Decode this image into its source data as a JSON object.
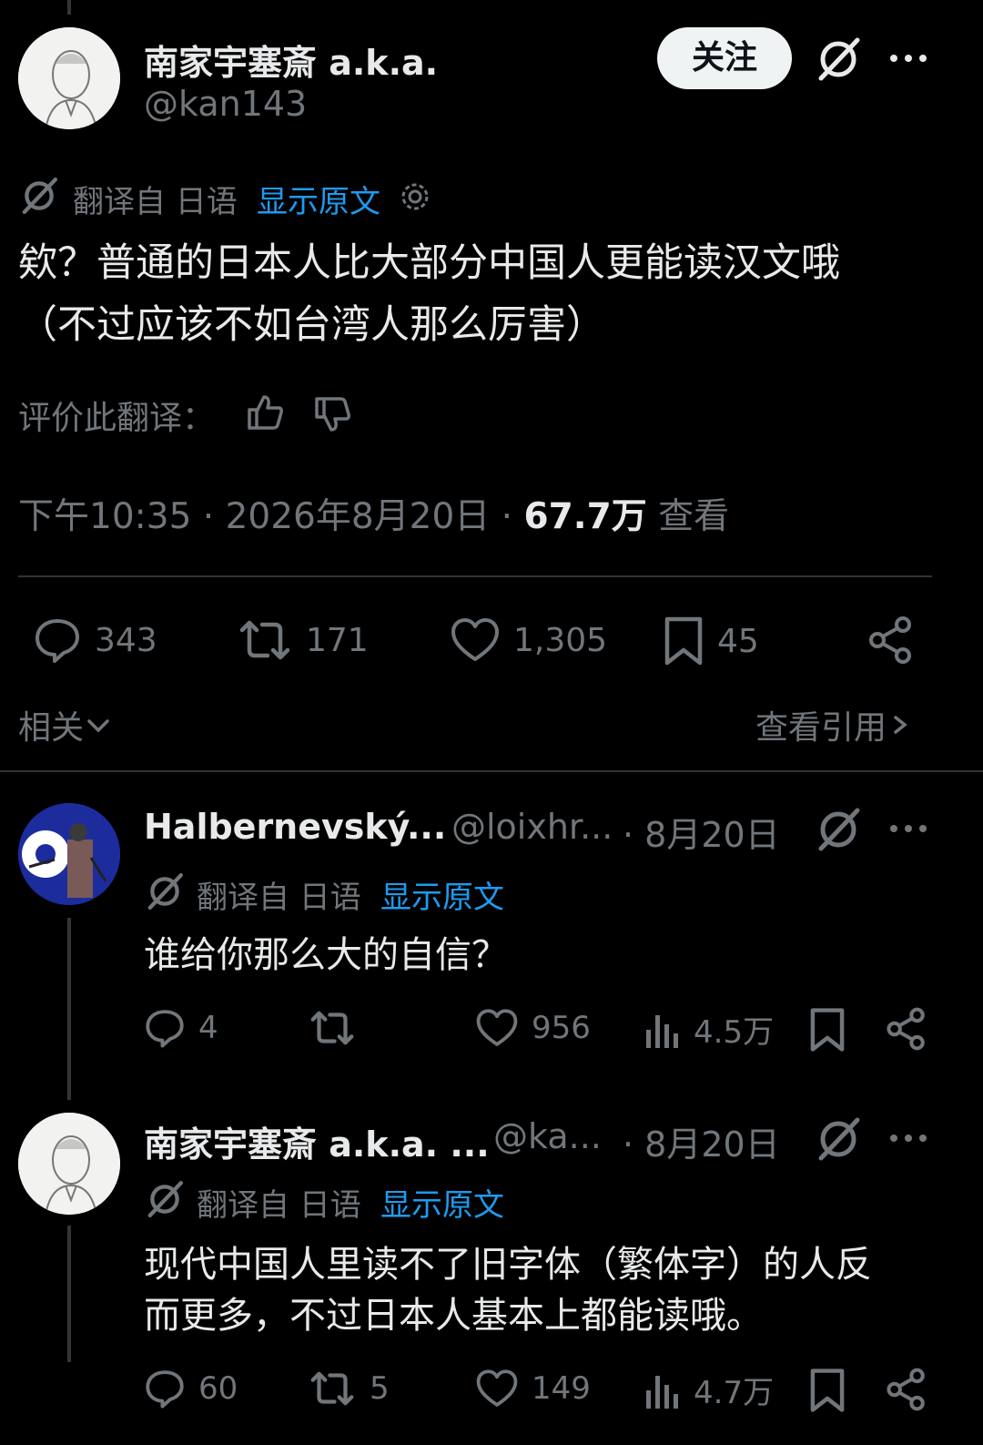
{
  "main_post": {
    "author_name": "南家宇塞斎 a.k.a.",
    "author_handle": "@kan143",
    "follow_label": "关注",
    "translated_from": "翻译自 日语",
    "show_original": "显示原文",
    "text_line1": "欸？普通的日本人比大部分中国人更能读汉文哦",
    "text_line2": "（不过应该不如台湾人那么厉害）",
    "rate_translation": "评价此翻译：",
    "time": "下午10:35 · 2026年8月20日 ·",
    "views_count": "67.7万",
    "views_label": "查看",
    "replies": "343",
    "reposts": "171",
    "likes": "1,305",
    "bookmarks": "45",
    "related_label": "相关",
    "view_quotes_label": "查看引用"
  },
  "replies": [
    {
      "author_name": "Halbernevský...",
      "author_handle": "@loixhr...",
      "date": "· 8月20日",
      "translated_from": "翻译自 日语",
      "show_original": "显示原文",
      "text": "谁给你那么大的自信？",
      "replies": "4",
      "reposts": "",
      "likes": "956",
      "views": "4.5万"
    },
    {
      "author_name": "南家宇塞斎 a.k.a. ...",
      "author_handle": "@ka...",
      "date": "· 8月20日",
      "translated_from": "翻译自 日语",
      "show_original": "显示原文",
      "text_line1": "现代中国人里读不了旧字体（繁体字）的人反",
      "text_line2": "而更多，不过日本人基本上都能读哦。",
      "replies": "60",
      "reposts": "5",
      "likes": "149",
      "views": "4.7万"
    }
  ],
  "icons": {
    "grok": "grok-slash-icon",
    "more": "more-dots-icon",
    "translate": "translate-icon",
    "settings": "gear-icon",
    "thumb_up": "thumbs-up-icon",
    "thumb_down": "thumbs-down-icon",
    "reply": "reply-bubble-icon",
    "repost": "repost-icon",
    "like": "heart-icon",
    "bookmark": "bookmark-icon",
    "share": "share-icon",
    "views": "views-bar-icon"
  },
  "colors": {
    "background": "#000000",
    "text": "#e7e9ea",
    "secondary": "#71767b",
    "link": "#1d9bf0",
    "follow_bg": "#eff3f4"
  }
}
